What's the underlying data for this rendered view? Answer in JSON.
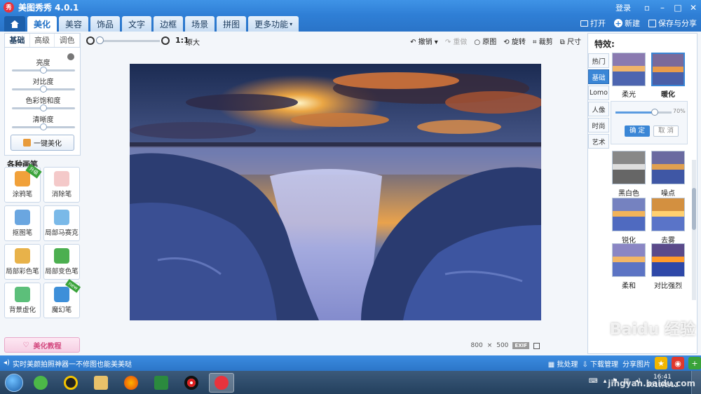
{
  "app": {
    "title": "美图秀秀 4.0.1",
    "login": "登录"
  },
  "tabs": [
    "美化",
    "美容",
    "饰品",
    "文字",
    "边框",
    "场景",
    "拼图"
  ],
  "tab_more": "更多功能",
  "header_actions": {
    "open": "打开",
    "new": "新建",
    "save_share": "保存与分享"
  },
  "left": {
    "subtabs": [
      "基础",
      "高级",
      "调色"
    ],
    "sliders": [
      {
        "label": "亮度",
        "value": 0.5
      },
      {
        "label": "对比度",
        "value": 0.5
      },
      {
        "label": "色彩饱和度",
        "value": 0.5
      },
      {
        "label": "清晰度",
        "value": 0.5
      }
    ],
    "one_key": "一键美化",
    "pens_title": "各种画笔",
    "pens": [
      {
        "label": "涂鸦笔",
        "badge": "升级",
        "color": "#f1a13a"
      },
      {
        "label": "消除笔",
        "badge": "",
        "color": "#f4c9c9"
      },
      {
        "label": "抠图笔",
        "badge": "",
        "color": "#6aa6e0"
      },
      {
        "label": "局部马赛克",
        "badge": "",
        "color": "#7ab9e8"
      },
      {
        "label": "局部彩色笔",
        "badge": "",
        "color": "#e8b24a"
      },
      {
        "label": "局部变色笔",
        "badge": "",
        "color": "#4caf50"
      },
      {
        "label": "背景虚化",
        "badge": "",
        "color": "#5cbf7a"
      },
      {
        "label": "魔幻笔",
        "badge": "new",
        "color": "#3d8fd9"
      }
    ],
    "tutorial": "美化教程"
  },
  "toolbar": {
    "ratio": "1:1",
    "enlarge": "原大",
    "undo": "撤销",
    "redo": "重做",
    "original": "原图",
    "rotate": "旋转",
    "crop": "裁剪",
    "size": "尺寸"
  },
  "image_info": {
    "width": "800",
    "times": "×",
    "height": "500",
    "exif": "EXIF"
  },
  "effects": {
    "title": "特效:",
    "categories": [
      "热门",
      "基础",
      "Lomo",
      "人像",
      "时尚",
      "艺术"
    ],
    "active_category": "基础",
    "opacity": "70%",
    "confirm": "确 定",
    "cancel": "取 消",
    "items": [
      "柔光",
      "暖化",
      "黑白色",
      "噪点",
      "锐化",
      "去雾",
      "柔和",
      "对比强烈"
    ]
  },
  "status": {
    "message": "实时美颜拍照神器一不修图也能美美哒",
    "batch": "批处理",
    "download": "下载管理",
    "share": "分享图片"
  },
  "clock": {
    "time": "16:41",
    "date": "2019/1/12"
  },
  "watermark": {
    "main": "Baidu 经验",
    "url": "jingyan.baidu.com"
  }
}
